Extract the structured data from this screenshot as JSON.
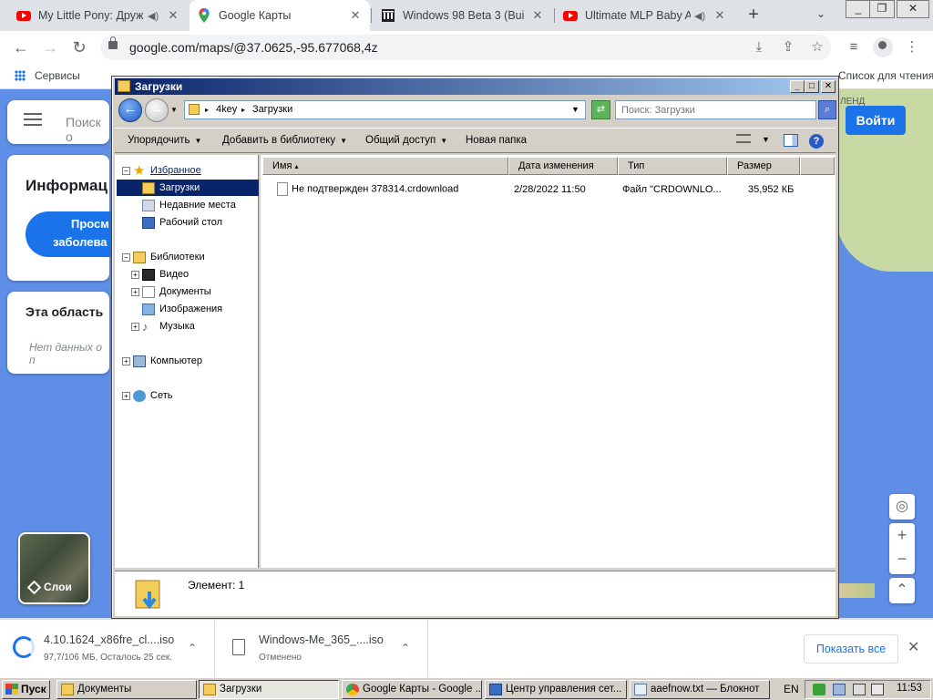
{
  "browser": {
    "tabs": [
      {
        "title": "My Little Pony: Друж",
        "favicon": "youtube-icon",
        "audio": true
      },
      {
        "title": "Google Карты",
        "favicon": "google-maps-icon",
        "audio": false
      },
      {
        "title": "Windows 98 Beta 3 (Buil",
        "favicon": "museum-icon",
        "audio": false
      },
      {
        "title": "Ultimate MLP Baby A",
        "favicon": "youtube-icon",
        "audio": true
      }
    ],
    "url": "google.com/maps/@37.0625,-95.677068,4z",
    "bookmarks": {
      "apps": "Сервисы",
      "reading_list": "Список для чтения"
    }
  },
  "maps": {
    "login": "Войти",
    "search_placeholder": "Поиск о",
    "info_title": "Информац",
    "info_button_line1": "Просм",
    "info_button_line2": "заболева",
    "area_title": "Эта область",
    "area_empty": "Нет данных о п",
    "layers": "Слои",
    "map_label": "ЛЕНД"
  },
  "explorer": {
    "title": "Загрузки",
    "breadcrumb": [
      "4key",
      "Загрузки"
    ],
    "search_placeholder": "Поиск: Загрузки",
    "commands": [
      "Упорядочить",
      "Добавить в библиотеку",
      "Общий доступ",
      "Новая папка"
    ],
    "nav": {
      "favorites": "Избранное",
      "favorites_items": [
        "Загрузки",
        "Недавние места",
        "Рабочий стол"
      ],
      "libraries": "Библиотеки",
      "libraries_items": [
        "Видео",
        "Документы",
        "Изображения",
        "Музыка"
      ],
      "computer": "Компьютер",
      "network": "Сеть"
    },
    "columns": [
      "Имя",
      "Дата изменения",
      "Тип",
      "Размер"
    ],
    "files": [
      {
        "name": "Не подтвержден 378314.crdownload",
        "modified": "2/28/2022 11:50",
        "type": "Файл \"CRDOWNLO...",
        "size": "35,952 КБ"
      }
    ],
    "status": "Элемент: 1"
  },
  "downloads": [
    {
      "name": "4.10.1624_x86fre_cl....iso",
      "status": "97,7/106 МБ, Осталось 25 сек."
    },
    {
      "name": "Windows-Me_365_....iso",
      "status": "Отменено"
    }
  ],
  "downloads_show_all": "Показать все",
  "taskbar": {
    "start": "Пуск",
    "tasks": [
      "Документы",
      "Загрузки",
      "Google Карты - Google ...",
      "Центр управления сет...",
      "aaefnow.txt — Блокнот"
    ],
    "language": "EN",
    "time": "11:53"
  },
  "colors": {
    "chrome_blue": "#1a73e8",
    "win_title": "#0a246a",
    "maps_water": "#5e8ee6"
  }
}
